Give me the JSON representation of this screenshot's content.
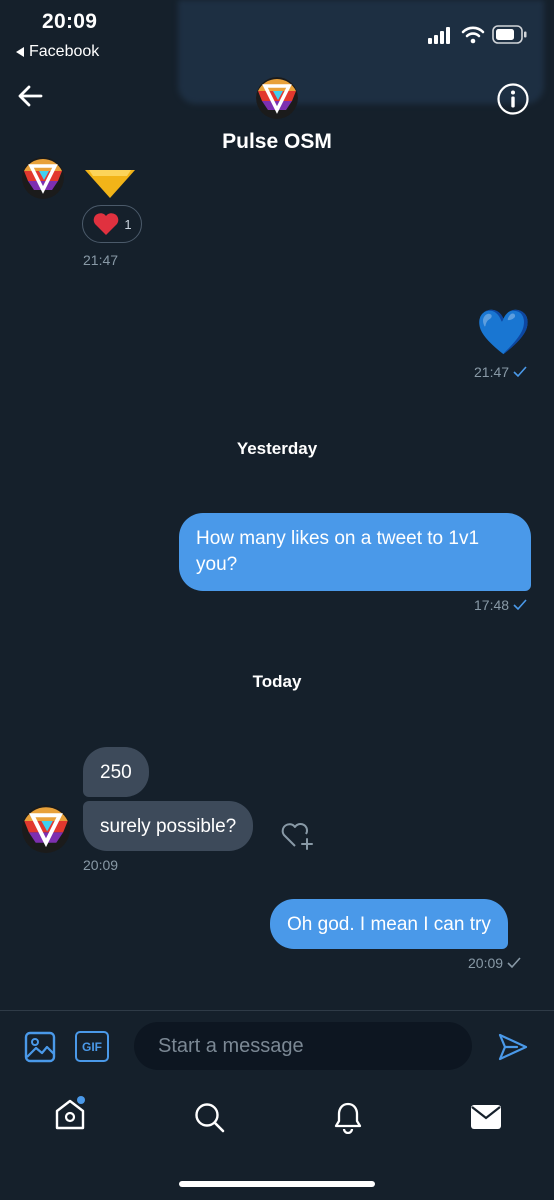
{
  "status_bar": {
    "time": "20:09",
    "back_app": "Facebook"
  },
  "header": {
    "title": "Pulse OSM"
  },
  "messages": {
    "m1": {
      "reaction_count": "1",
      "time": "21:47"
    },
    "m2": {
      "emoji": "💙",
      "time": "21:47"
    },
    "divider_yesterday": "Yesterday",
    "m3": {
      "text_line1": "How many likes on a tweet to 1v1",
      "text_line2": "you?",
      "time": "17:48"
    },
    "divider_today": "Today",
    "m4": {
      "text": "250"
    },
    "m5": {
      "text": "surely possible?",
      "time": "20:09"
    },
    "m6": {
      "text": "Oh god. I mean I can try",
      "time": "20:09"
    }
  },
  "composer": {
    "placeholder": "Start a message",
    "gif_label": "GIF"
  },
  "colors": {
    "background": "#15202b",
    "accent": "#4a99e9",
    "incoming_bubble": "#3d4a5a",
    "muted_text": "#8899a6"
  },
  "icons": [
    "back-arrow-icon",
    "info-icon",
    "image-icon",
    "gif-icon",
    "send-icon",
    "home-icon",
    "search-icon",
    "bell-icon",
    "mail-icon",
    "heart-icon",
    "add-reaction-icon",
    "checkmark-icon",
    "signal-icon",
    "wifi-icon",
    "battery-icon"
  ]
}
